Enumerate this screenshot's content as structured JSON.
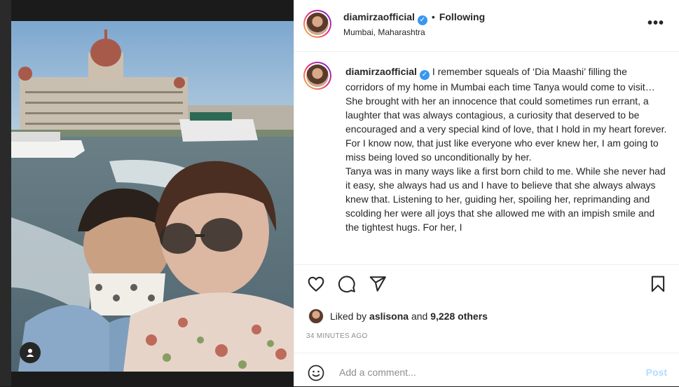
{
  "post": {
    "username": "diamirzaofficial",
    "following_label": "Following",
    "separator": "•",
    "location": "Mumbai, Maharashtra",
    "more_label": "•••",
    "caption_username": "diamirzaofficial",
    "caption_paragraphs": [
      "I remember squeals of ‘Dia Maashi’ filling the corridors of my home in Mumbai each time Tanya would come to visit…",
      "She brought with her an innocence that could sometimes run errant, a laughter that was always contagious, a curiosity that deserved to be encouraged and a very special kind of love, that I hold in my heart forever. For I know now, that just like everyone who ever knew her, I am going to miss being loved so unconditionally by her.",
      "Tanya was in many ways like a first born child to me. While she never had it easy, she always had us and I have to believe that she always always knew that. Listening to her, guiding her, spoiling her, reprimanding and scolding her were all joys that she allowed me with an impish smile and the tightest hugs. For her, I"
    ],
    "likes": {
      "prefix": "Liked by",
      "user": "aslisona",
      "middle": "and",
      "count": "9,228 others"
    },
    "timestamp": "34 MINUTES AGO",
    "comment_placeholder": "Add a comment...",
    "post_label": "Post"
  },
  "colors": {
    "verified": "#3897f0",
    "post_button": "#b3dbff",
    "muted": "#8e8e8e",
    "text": "#262626"
  },
  "icons": [
    "heart-icon",
    "comment-icon",
    "share-icon",
    "bookmark-icon",
    "emoji-icon",
    "user-tag-icon",
    "verified-icon",
    "more-icon"
  ]
}
